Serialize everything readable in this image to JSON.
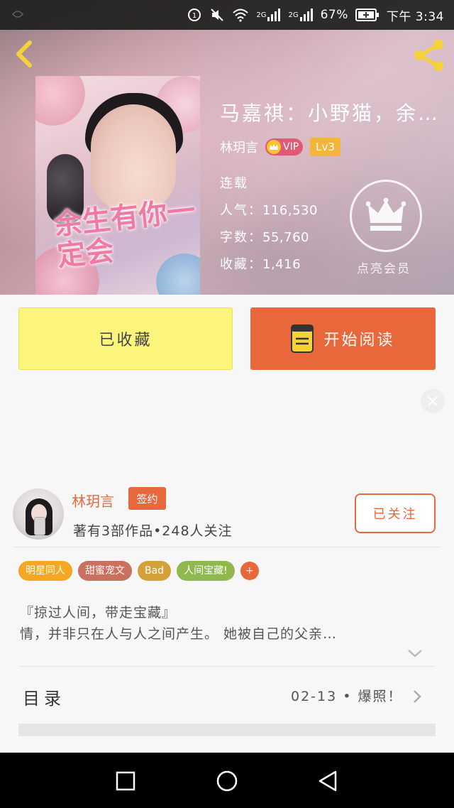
{
  "status_bar": {
    "time": "下午 3:34",
    "battery": "67%",
    "network_1": "2G",
    "network_2": "2G"
  },
  "header": {
    "back_icon": "back-arrow-icon",
    "share_icon": "share-icon"
  },
  "book": {
    "title": "马嘉祺：小野猫，余…",
    "author": "林玥言",
    "vip_label": "VIP",
    "level": "Lv3",
    "status": "连载",
    "popularity_label": "人气：",
    "popularity_value": "116,530",
    "word_count_label": "字数：",
    "word_count_value": "55,760",
    "favorites_label": "收藏：",
    "favorites_value": "1,416",
    "cover_text": "余生有你一定会",
    "vip_member_label": "点亮会员"
  },
  "actions": {
    "collected_label": "已收藏",
    "read_label": "开始阅读"
  },
  "author_card": {
    "name": "林玥言",
    "signed_label": "签约",
    "stats": "著有3部作品•248人关注",
    "follow_label": "已关注"
  },
  "tags": [
    {
      "label": "明星同人",
      "color": "#f5a623"
    },
    {
      "label": "甜蜜宠文",
      "color": "#c9705e"
    },
    {
      "label": "Bad",
      "color": "#d4a03a"
    },
    {
      "label": "人间宝藏!",
      "color": "#8fb84e"
    }
  ],
  "tag_more_label": "+",
  "tag_more_color": "#e8683c",
  "description": {
    "line1": "『掠过人间，带走宝藏』",
    "line2": "情，并非只在人与人之间产生。 她被自己的父亲…"
  },
  "catalog": {
    "label": "目录",
    "latest": "02-13 • 爆照！"
  },
  "colors": {
    "accent": "#e8683c",
    "collected_bg": "#fbf57c",
    "vip": "#e05a74",
    "level": "#f5b43a"
  }
}
